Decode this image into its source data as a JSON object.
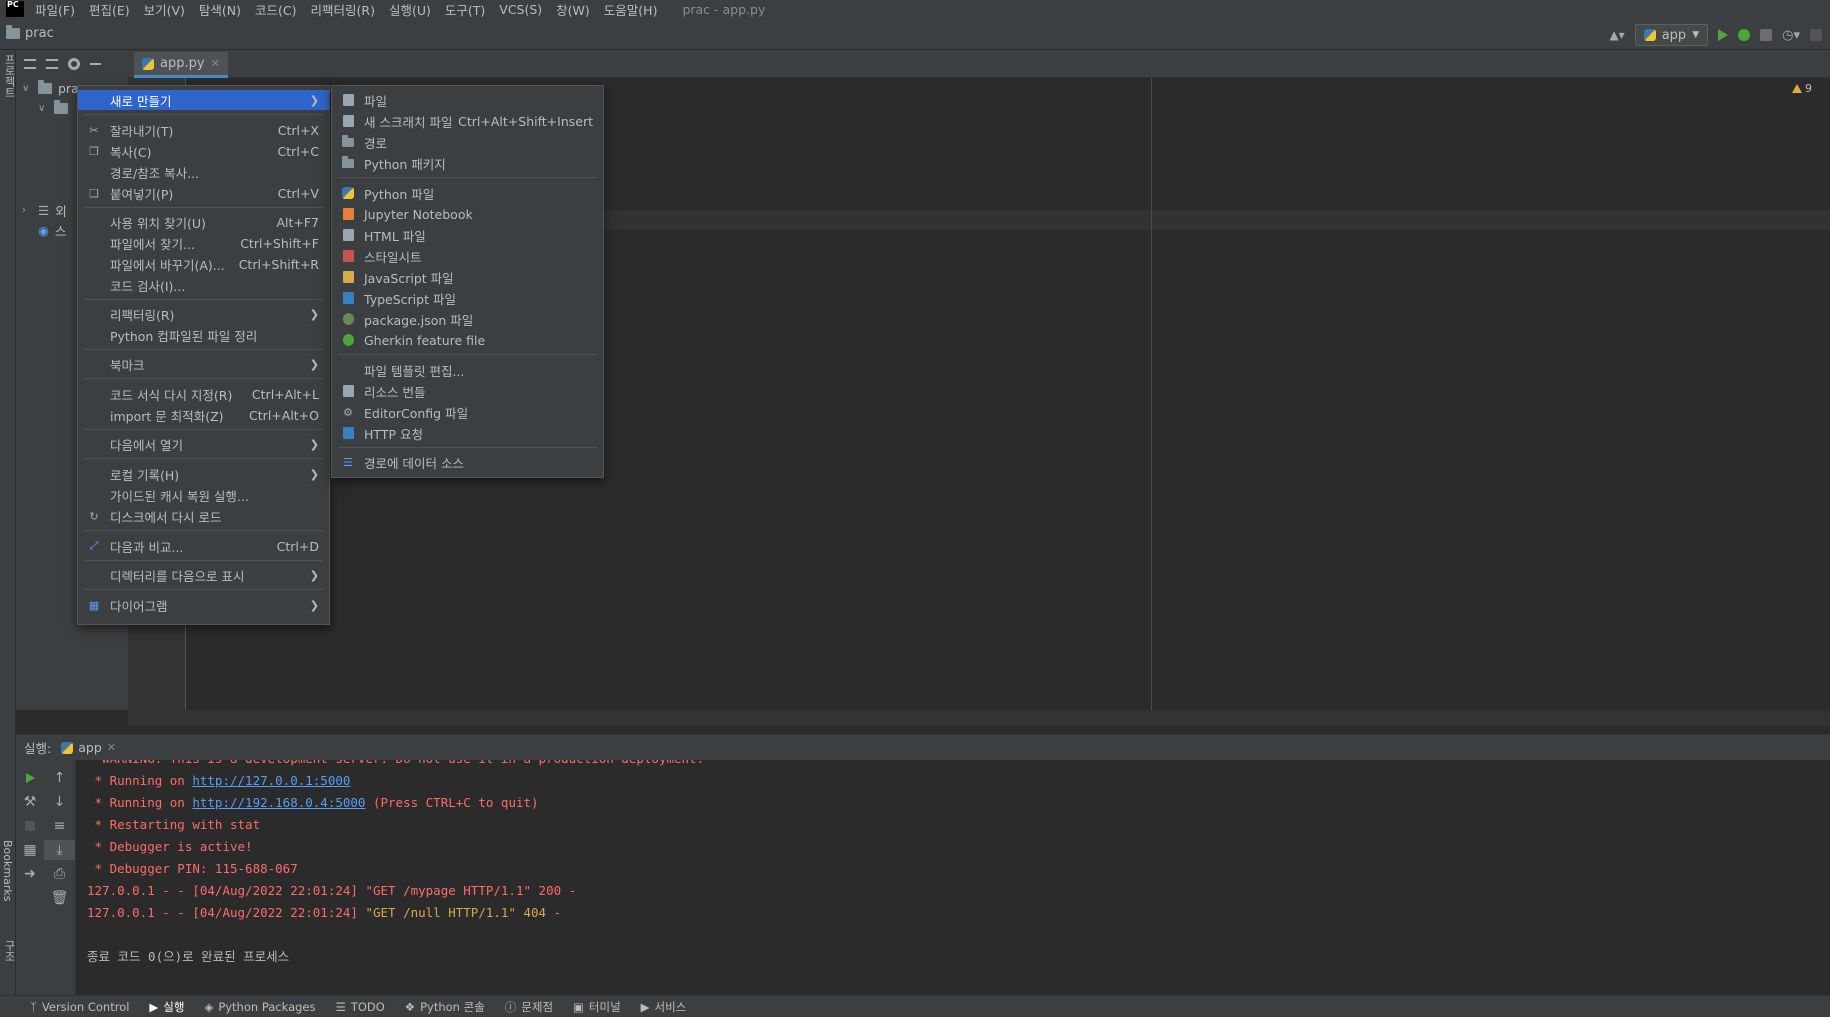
{
  "menubar": {
    "logo": "PC",
    "items": [
      "파일(F)",
      "편집(E)",
      "보기(V)",
      "탐색(N)",
      "코드(C)",
      "리팩터링(R)",
      "실행(U)",
      "도구(T)",
      "VCS(S)",
      "창(W)",
      "도움말(H)"
    ],
    "window_title": "prac - app.py"
  },
  "navbar": {
    "project": "prac",
    "run_config": "app"
  },
  "left_stripe": {
    "project_label": "프로젝트",
    "bookmarks_label": "Bookmarks",
    "structure_label": "구조"
  },
  "editor": {
    "tab": "app.py",
    "warnings": "9"
  },
  "project_tree": {
    "root": "pra",
    "external_libs": "외",
    "scratches": "스"
  },
  "context_menu": {
    "items": [
      {
        "label": "새로 만들기",
        "shortcut": "",
        "submenu": true,
        "icon": ""
      },
      {
        "label": "잘라내기(T)",
        "shortcut": "Ctrl+X",
        "icon": "scissors-icon"
      },
      {
        "label": "복사(C)",
        "shortcut": "Ctrl+C",
        "icon": "copy-icon"
      },
      {
        "label": "경로/참조 복사...",
        "shortcut": "",
        "icon": ""
      },
      {
        "label": "붙여넣기(P)",
        "shortcut": "Ctrl+V",
        "icon": "paste-icon"
      },
      {
        "label": "사용 위치 찾기(U)",
        "shortcut": "Alt+F7",
        "icon": ""
      },
      {
        "label": "파일에서 찾기...",
        "shortcut": "Ctrl+Shift+F",
        "icon": ""
      },
      {
        "label": "파일에서 바꾸기(A)...",
        "shortcut": "Ctrl+Shift+R",
        "icon": ""
      },
      {
        "label": "코드 검사(I)...",
        "shortcut": "",
        "icon": ""
      },
      {
        "label": "리팩터링(R)",
        "shortcut": "",
        "submenu": true,
        "icon": ""
      },
      {
        "label": "Python 컴파일된 파일 정리",
        "shortcut": "",
        "icon": ""
      },
      {
        "label": "북마크",
        "shortcut": "",
        "submenu": true,
        "icon": ""
      },
      {
        "label": "코드 서식 다시 지정(R)",
        "shortcut": "Ctrl+Alt+L",
        "icon": ""
      },
      {
        "label": "import 문 최적화(Z)",
        "shortcut": "Ctrl+Alt+O",
        "icon": ""
      },
      {
        "label": "다음에서 열기",
        "shortcut": "",
        "submenu": true,
        "icon": ""
      },
      {
        "label": "로컬 기록(H)",
        "shortcut": "",
        "submenu": true,
        "icon": ""
      },
      {
        "label": "가이드된 캐시 복원 실행...",
        "shortcut": "",
        "icon": ""
      },
      {
        "label": "디스크에서 다시 로드",
        "shortcut": "",
        "icon": "reload-icon"
      },
      {
        "label": "다음과 비교...",
        "shortcut": "Ctrl+D",
        "icon": "compare-icon"
      },
      {
        "label": "디렉터리를 다음으로 표시",
        "shortcut": "",
        "submenu": true,
        "icon": ""
      },
      {
        "label": "다이어그램",
        "shortcut": "",
        "submenu": true,
        "icon": "diagram-icon"
      }
    ]
  },
  "submenu": {
    "items": [
      {
        "label": "파일",
        "shortcut": "",
        "icon": "file-icon",
        "color": "#9aa7b0"
      },
      {
        "label": "새 스크래치 파일",
        "shortcut": "Ctrl+Alt+Shift+Insert",
        "icon": "scratch-file-icon",
        "color": "#9aa7b0"
      },
      {
        "label": "경로",
        "shortcut": "",
        "icon": "folder-icon",
        "color": "#87939a"
      },
      {
        "label": "Python 패키지",
        "shortcut": "",
        "icon": "package-icon",
        "color": "#87939a"
      },
      {
        "label": "Python 파일",
        "shortcut": "",
        "icon": "python-file-icon",
        "color": "#3c78aa"
      },
      {
        "label": "Jupyter Notebook",
        "shortcut": "",
        "icon": "jupyter-icon",
        "color": "#e8803a"
      },
      {
        "label": "HTML 파일",
        "shortcut": "",
        "icon": "html-file-icon",
        "color": "#9aa7b0"
      },
      {
        "label": "스타일시트",
        "shortcut": "",
        "icon": "css-file-icon",
        "color": "#c75450"
      },
      {
        "label": "JavaScript 파일",
        "shortcut": "",
        "icon": "js-file-icon",
        "color": "#d6a94a"
      },
      {
        "label": "TypeScript 파일",
        "shortcut": "",
        "icon": "ts-file-icon",
        "color": "#3a80c0"
      },
      {
        "label": "package.json 파일",
        "shortcut": "",
        "icon": "package-json-icon",
        "color": "#6a8759"
      },
      {
        "label": "Gherkin feature file",
        "shortcut": "",
        "icon": "gherkin-icon",
        "color": "#4fa53a"
      },
      {
        "label": "파일 템플릿 편집...",
        "shortcut": "",
        "icon": "",
        "color": ""
      },
      {
        "label": "리소스 번들",
        "shortcut": "",
        "icon": "resource-bundle-icon",
        "color": "#9aa7b0"
      },
      {
        "label": "EditorConfig 파일",
        "shortcut": "",
        "icon": "editorconfig-icon",
        "color": "#aaaaaa"
      },
      {
        "label": "HTTP 요청",
        "shortcut": "",
        "icon": "http-request-icon",
        "color": "#3a80c0"
      },
      {
        "label": "경로에 데이터 소스",
        "shortcut": "",
        "icon": "datasource-icon",
        "color": "#3a80c0"
      }
    ]
  },
  "run_panel": {
    "label": "실행:",
    "tab": "app",
    "lines": [
      {
        "text": "  WARNING: This is a development server. Do not use it in a production deployment.",
        "class": "red"
      },
      {
        "pre": " * Running on ",
        "link": "http://127.0.0.1:5000",
        "post": ""
      },
      {
        "pre": " * Running on ",
        "link": "http://192.168.0.4:5000",
        "post": " (Press CTRL+C to quit)"
      },
      {
        "text": " * Restarting with stat",
        "class": "red"
      },
      {
        "text": " * Debugger is active!",
        "class": "red"
      },
      {
        "text": " * Debugger PIN: 115-688-067",
        "class": "red"
      },
      {
        "text": "127.0.0.1 - - [04/Aug/2022 22:01:24] \"GET /mypage HTTP/1.1\" 200 -",
        "class": "red"
      },
      {
        "pre": "127.0.0.1 - - [04/Aug/2022 22:01:24] ",
        "yellow": "\"GET /null HTTP/1.1\" 404",
        "post": " -"
      },
      {
        "text": "",
        "class": "gray"
      },
      {
        "text": "종료 코드 0(으)로 완료된 프로세스",
        "class": "gray"
      }
    ]
  },
  "statusbar": {
    "items": [
      "Version Control",
      "실행",
      "Python Packages",
      "TODO",
      "Python 콘솔",
      "문제점",
      "터미널",
      "서비스"
    ]
  }
}
